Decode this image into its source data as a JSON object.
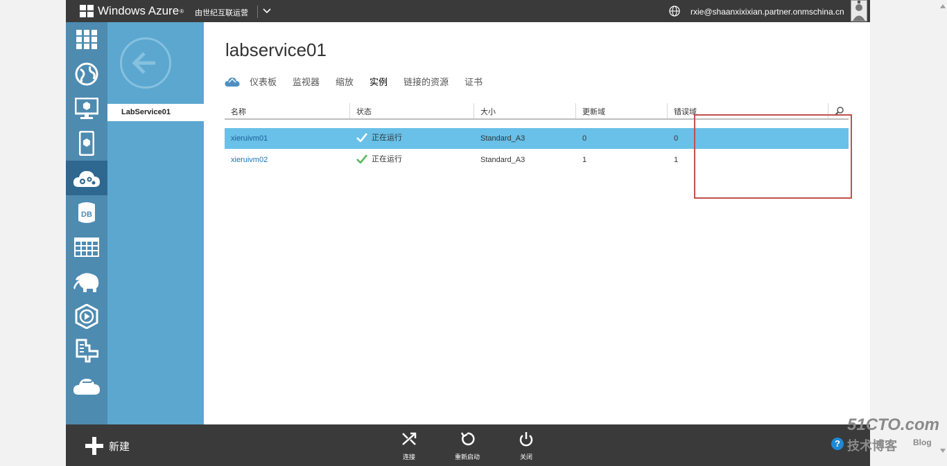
{
  "topbar": {
    "brand": "Windows Azure",
    "operator": "由世纪互联运营",
    "user_email": "rxie@shaanxixixian.partner.onmschina.cn"
  },
  "left_rail": {
    "icons": [
      "all-items-icon",
      "websites-icon",
      "virtual-machines-icon",
      "mobile-services-icon",
      "cloud-services-icon",
      "sql-databases-icon",
      "storage-icon",
      "hdinsight-icon",
      "media-services-icon",
      "service-bus-icon",
      "networks-icon"
    ],
    "active_index": 4
  },
  "subnav": {
    "item": "LabService01"
  },
  "page": {
    "title": "labservice01"
  },
  "tabs": [
    "仪表板",
    "监视器",
    "缩放",
    "实例",
    "链接的资源",
    "证书"
  ],
  "active_tab": "实例",
  "table": {
    "columns": [
      "名称",
      "状态",
      "大小",
      "更新域",
      "错误域"
    ],
    "rows": [
      {
        "name": "xieruivm01",
        "status": "正在运行",
        "size": "Standard_A3",
        "update_domain": "0",
        "fault_domain": "0",
        "selected": true
      },
      {
        "name": "xieruivm02",
        "status": "正在运行",
        "size": "Standard_A3",
        "update_domain": "1",
        "fault_domain": "1",
        "selected": false
      }
    ]
  },
  "bottombar": {
    "new_label": "新建",
    "commands": [
      "连接",
      "重新启动",
      "关闭"
    ],
    "help": "?"
  },
  "watermark": {
    "line1": "51CTO.com",
    "line2": "技术博客",
    "line3": "Blog"
  },
  "colors": {
    "topbar": "#3a3a3a",
    "rail": "#4d8bb1",
    "subnav": "#5ba7cf",
    "selected_row": "#69c0e8",
    "status_ok": "#5cb85c",
    "highlight_box": "#c0504d"
  }
}
